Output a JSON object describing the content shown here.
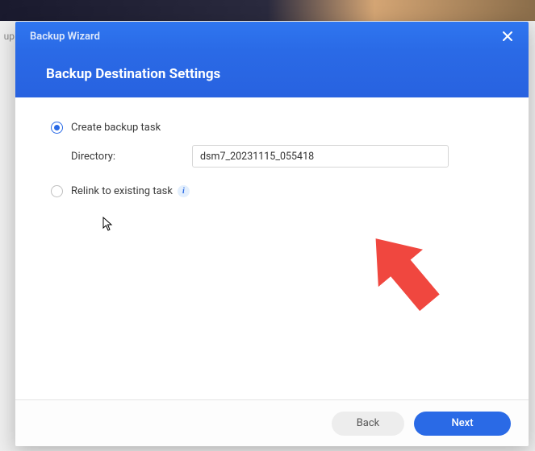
{
  "backdrop_label": "up",
  "modal": {
    "title": "Backup Wizard",
    "subtitle": "Backup Destination Settings"
  },
  "options": {
    "create_label": "Create backup task",
    "relink_label": "Relink to existing task"
  },
  "directory": {
    "label": "Directory:",
    "value": "dsm7_20231115_055418"
  },
  "footer": {
    "back": "Back",
    "next": "Next"
  },
  "colors": {
    "primary": "#2a6ae6",
    "arrow": "#f0473f"
  }
}
